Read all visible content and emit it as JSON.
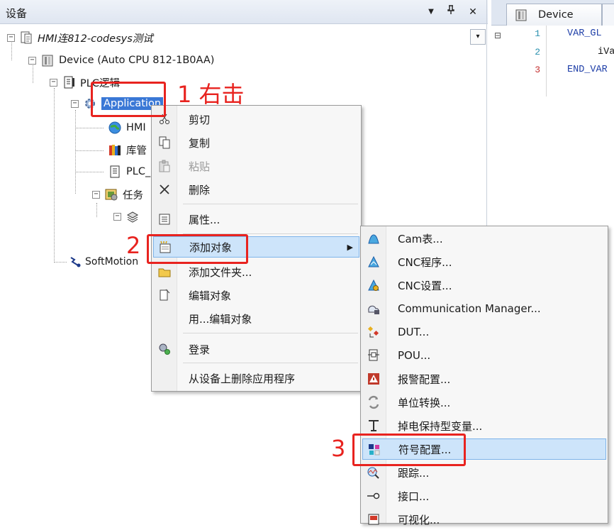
{
  "pane": {
    "title": "设备",
    "btn_dropdown": "▼",
    "btn_pin": "ᵩ",
    "btn_close": "✕",
    "tree_dropdown": "▾"
  },
  "tree": {
    "project": "HMI连812-codesys测试",
    "device": "Device (Auto CPU 812-1B0AA)",
    "plc_logic": "PLC逻辑",
    "application": "Application",
    "hmi": "HMI",
    "lib": "库管",
    "plc_prg": "PLC_",
    "tasks": "任务",
    "softmotion": "SoftMotion"
  },
  "editor": {
    "tab_label": "Device",
    "lines": [
      {
        "no": "1",
        "text": "VAR_GL"
      },
      {
        "no": "2",
        "text": "iVa"
      },
      {
        "no": "3",
        "text": "END_VAR"
      }
    ]
  },
  "context_menu": {
    "items": [
      {
        "label": "剪切",
        "icon": "scissors-icon",
        "enabled": true
      },
      {
        "label": "复制",
        "icon": "copy-icon",
        "enabled": true
      },
      {
        "label": "粘贴",
        "icon": "paste-icon",
        "enabled": false
      },
      {
        "label": "删除",
        "icon": "delete-icon",
        "enabled": true
      },
      {
        "label": "属性...",
        "icon": "properties-icon",
        "enabled": true
      },
      {
        "label": "添加对象",
        "icon": "add-object-icon",
        "enabled": true,
        "submenu": true
      },
      {
        "label": "添加文件夹...",
        "icon": "folder-icon",
        "enabled": true
      },
      {
        "label": "编辑对象",
        "icon": "edit-object-icon",
        "enabled": true
      },
      {
        "label": "用...编辑对象",
        "icon": "",
        "enabled": true
      },
      {
        "label": "登录",
        "icon": "login-icon",
        "enabled": true
      },
      {
        "label": "从设备上删除应用程序",
        "icon": "",
        "enabled": true
      }
    ]
  },
  "submenu": {
    "items": [
      {
        "label": "Cam表...",
        "icon": "cam-table-icon"
      },
      {
        "label": "CNC程序...",
        "icon": "cnc-program-icon"
      },
      {
        "label": "CNC设置...",
        "icon": "cnc-settings-icon"
      },
      {
        "label": "Communication Manager...",
        "icon": "communication-manager-icon"
      },
      {
        "label": "DUT...",
        "icon": "dut-icon"
      },
      {
        "label": "POU...",
        "icon": "pou-icon"
      },
      {
        "label": "报警配置...",
        "icon": "alarm-config-icon"
      },
      {
        "label": "单位转换...",
        "icon": "unit-conversion-icon"
      },
      {
        "label": "掉电保持型变量...",
        "icon": "persistent-vars-icon"
      },
      {
        "label": "符号配置...",
        "icon": "symbol-config-icon"
      },
      {
        "label": "跟踪...",
        "icon": "trace-icon"
      },
      {
        "label": "接口...",
        "icon": "interface-icon"
      },
      {
        "label": "可视化...",
        "icon": "visualization-icon"
      }
    ]
  },
  "annotations": {
    "step1": "1 右击",
    "step2": "2",
    "step3": "3"
  },
  "colors": {
    "annotation_red": "#e8231f",
    "selection_blue": "#3a78d6",
    "menu_highlight": "#cde4fa"
  }
}
